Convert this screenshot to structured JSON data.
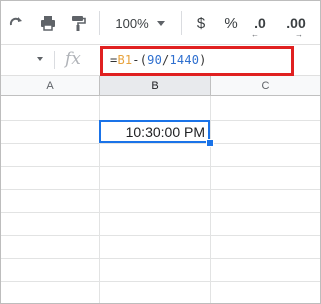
{
  "toolbar": {
    "zoom": "100%",
    "currency_label": "$",
    "percent_label": "%",
    "decrease_decimal_label": ".0",
    "increase_decimal_label": ".00"
  },
  "formula_bar": {
    "fx_label": "fx",
    "formula": {
      "eq": "=",
      "ref": "B1",
      "op": "-",
      "open_paren": "(",
      "num1": "90",
      "div": "/",
      "num2": "1440",
      "close_paren": ")"
    },
    "highlight_color": "#e02020"
  },
  "columns": [
    "A",
    "B",
    "C"
  ],
  "cells": {
    "B2": "10:30:00 PM"
  },
  "colors": {
    "selection": "#1a73e8",
    "formula_ref": "#e8a33d",
    "formula_number": "#2e6fcf"
  }
}
